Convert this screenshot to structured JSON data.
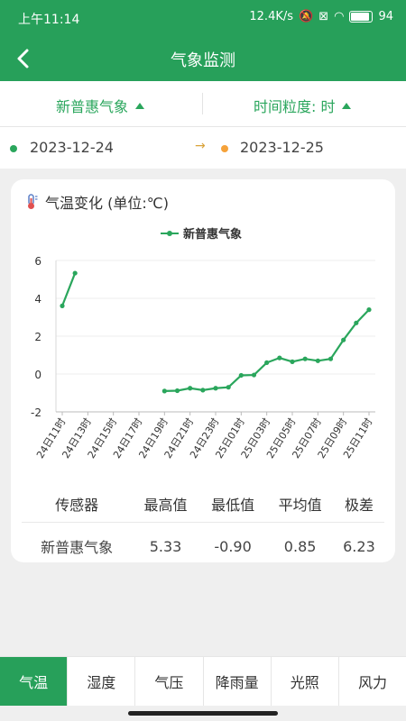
{
  "status": {
    "time": "上午11:14",
    "speed": "12.4K/s",
    "battery": "94"
  },
  "appbar": {
    "title": "气象监测"
  },
  "filters": {
    "station": "新普惠气象",
    "granularity": "时间粒度: 时"
  },
  "dates": {
    "start": "2023-12-24",
    "end": "2023-12-25",
    "arrow": "→"
  },
  "card": {
    "title": "气温变化 (单位:℃)"
  },
  "chart_data": {
    "type": "line",
    "series": [
      {
        "name": "新普惠气象",
        "color": "#2aa65c",
        "points": [
          [
            "24日11时",
            3.6
          ],
          [
            "24日12时",
            5.33
          ],
          [
            "24日19时",
            -0.9
          ],
          [
            "24日20时",
            -0.88
          ],
          [
            "24日21时",
            -0.75
          ],
          [
            "24日22时",
            -0.85
          ],
          [
            "24日23时",
            -0.75
          ],
          [
            "25日00时",
            -0.7
          ],
          [
            "25日01时",
            -0.07
          ],
          [
            "25日02时",
            -0.05
          ],
          [
            "25日03时",
            0.6
          ],
          [
            "25日04时",
            0.85
          ],
          [
            "25日05时",
            0.65
          ],
          [
            "25日06时",
            0.8
          ],
          [
            "25日07时",
            0.7
          ],
          [
            "25日08时",
            0.8
          ],
          [
            "25日09时",
            1.8
          ],
          [
            "25日10时",
            2.7
          ],
          [
            "25日11时",
            3.4
          ]
        ]
      }
    ],
    "x_tick_labels": [
      "24日11时",
      "24日13时",
      "24日15时",
      "24日17时",
      "24日19时",
      "24日21时",
      "24日23时",
      "25日01时",
      "25日03时",
      "25日05时",
      "25日07时",
      "25日09时",
      "25日11时"
    ],
    "y_ticks": [
      6,
      4,
      2,
      0,
      -2
    ],
    "ylim": [
      -2,
      6
    ],
    "legend": "top-center",
    "grid": true
  },
  "table": {
    "headers": [
      "传感器",
      "最高值",
      "最低值",
      "平均值",
      "极差"
    ],
    "rows": [
      [
        "新普惠气象",
        "5.33",
        "-0.90",
        "0.85",
        "6.23"
      ]
    ]
  },
  "tabs": [
    "气温",
    "湿度",
    "气压",
    "降雨量",
    "光照",
    "风力"
  ],
  "active_tab": "气温"
}
